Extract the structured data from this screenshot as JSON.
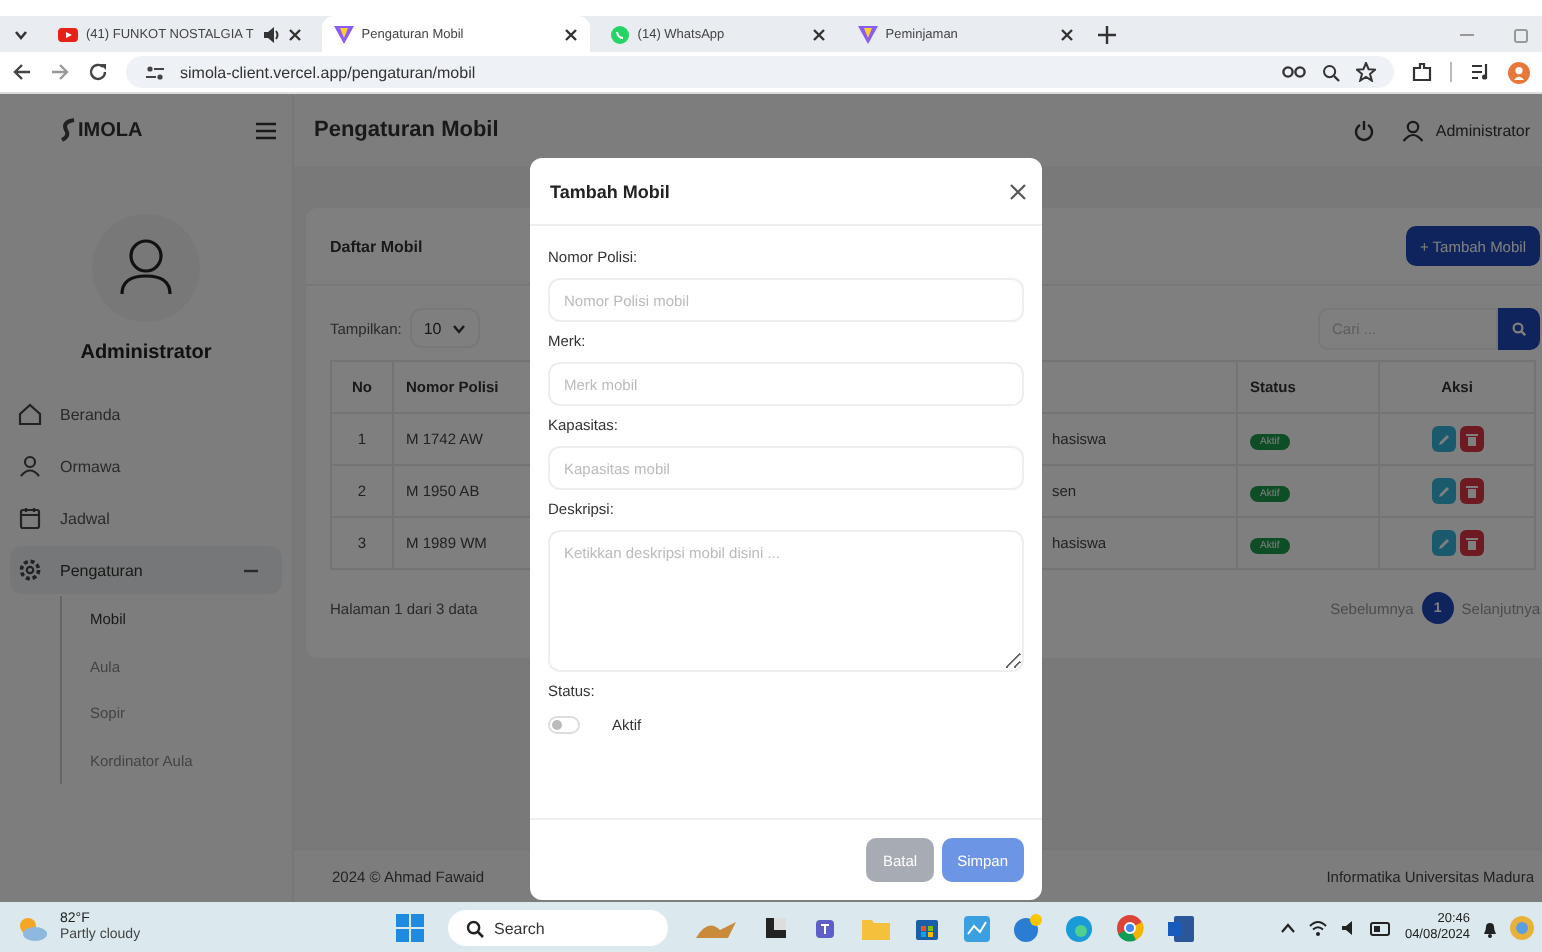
{
  "browser": {
    "tabs": [
      {
        "title": "(41) FUNKOT NOSTALGIA T",
        "kind": "youtube",
        "audio": true,
        "selected": false
      },
      {
        "title": "Pengaturan Mobil",
        "kind": "vite",
        "audio": false,
        "selected": true
      },
      {
        "title": "(14) WhatsApp",
        "kind": "whatsapp",
        "audio": false,
        "selected": false
      },
      {
        "title": "Peminjaman",
        "kind": "vite",
        "audio": false,
        "selected": false
      }
    ],
    "address": "simola-client.vercel.app/pengaturan/mobil"
  },
  "header": {
    "logo": "IMOLA",
    "page_title": "Pengaturan Mobil",
    "user": "Administrator"
  },
  "sidebar": {
    "user": "Administrator",
    "items": [
      {
        "label": "Beranda",
        "kind": "home",
        "selected": false
      },
      {
        "label": "Ormawa",
        "kind": "person",
        "selected": false
      },
      {
        "label": "Jadwal",
        "kind": "calendar",
        "selected": false
      },
      {
        "label": "Pengaturan",
        "kind": "gear",
        "selected": true,
        "expanded": true,
        "children": [
          {
            "label": "Mobil",
            "selected": true
          },
          {
            "label": "Aula",
            "selected": false
          },
          {
            "label": "Sopir",
            "selected": false
          },
          {
            "label": "Kordinator Aula",
            "selected": false
          }
        ]
      }
    ]
  },
  "card": {
    "title": "Daftar Mobil",
    "add_button": "+ Tambah Mobil",
    "show_label": "Tampilkan:",
    "show_value": "10",
    "search": {
      "placeholder": "Cari ..."
    },
    "table": {
      "columns": [
        "No",
        "Nomor Polisi",
        "Status",
        "Aksi"
      ],
      "rows": [
        {
          "no": "1",
          "nomor_polisi": "M 1742 AW",
          "column_3": "hasiswa",
          "status": "Aktif"
        },
        {
          "no": "2",
          "nomor_polisi": "M 1950 AB",
          "column_3": "sen",
          "status": "Aktif"
        },
        {
          "no": "3",
          "nomor_polisi": "M 1989 WM",
          "column_3": "hasiswa",
          "status": "Aktif"
        }
      ]
    },
    "info": "Halaman 1 dari 3 data",
    "pagination": {
      "prev": "Sebelumnya",
      "pages": [
        {
          "label": "1",
          "selected": true
        }
      ],
      "next": "Selanjutnya"
    }
  },
  "footer": {
    "left": "2024 © Ahmad Fawaid",
    "right": "Informatika Universitas Madura"
  },
  "modal": {
    "title": "Tambah Mobil",
    "fields": [
      {
        "label": "Nomor Polisi:",
        "kind": "input",
        "placeholder": "Nomor Polisi mobil"
      },
      {
        "label": "Merk:",
        "kind": "input",
        "placeholder": "Merk mobil"
      },
      {
        "label": "Kapasitas:",
        "kind": "input",
        "placeholder": "Kapasitas mobil"
      },
      {
        "label": "Deskripsi:",
        "kind": "textarea",
        "placeholder": "Ketikkan deskripsi mobil disini ..."
      }
    ],
    "status": {
      "label": "Status:",
      "toggle_label": "Aktif",
      "on": false
    },
    "buttons": [
      {
        "label": "Batal",
        "kind": "secondary"
      },
      {
        "label": "Simpan",
        "kind": "primary"
      }
    ]
  },
  "taskbar": {
    "weather": {
      "temp": "82°F",
      "condition": "Partly cloudy"
    },
    "search": {
      "placeholder": "Search"
    },
    "time": "20:46",
    "date": "04/08/2024"
  }
}
